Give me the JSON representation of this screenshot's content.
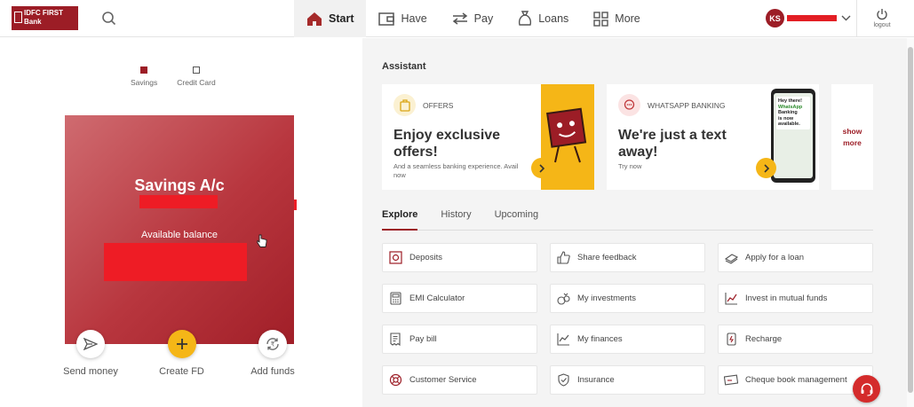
{
  "brand": {
    "logo_text_1": "IDFC FIRST",
    "logo_text_2": "Bank"
  },
  "nav": {
    "items": [
      {
        "label": "Start",
        "icon": "home-icon",
        "active": true
      },
      {
        "label": "Have",
        "icon": "wallet-icon",
        "active": false
      },
      {
        "label": "Pay",
        "icon": "transfer-arrows-icon",
        "active": false
      },
      {
        "label": "Loans",
        "icon": "money-bag-icon",
        "active": false
      },
      {
        "label": "More",
        "icon": "grid-icon",
        "active": false
      }
    ]
  },
  "user": {
    "initials": "KS"
  },
  "logout_label": "logout",
  "account_tabs": [
    {
      "label": "Savings",
      "active": true
    },
    {
      "label": "Credit Card",
      "active": false
    }
  ],
  "account_card": {
    "title": "Savings A/c",
    "balance_label": "Available balance"
  },
  "quick_actions": [
    {
      "label": "Send money",
      "icon": "send-icon"
    },
    {
      "label": "Create FD",
      "icon": "plus-icon"
    },
    {
      "label": "Add funds",
      "icon": "refresh-money-icon"
    }
  ],
  "assistant": {
    "title": "Assistant",
    "cards": [
      {
        "tag": "OFFERS",
        "headline_1": "Enjoy exclusive",
        "headline_2": "offers!",
        "sub_1": "And a seamless banking experience. Avail",
        "sub_2": "now"
      },
      {
        "tag": "WHATSAPP BANKING",
        "headline_1": "We're just a text",
        "headline_2": "away!",
        "sub_1": "Try now",
        "sub_2": ""
      }
    ],
    "phone_text": {
      "line1": "Hey there!",
      "line2": "WhatsApp",
      "line3": "Banking",
      "line4": "is now",
      "line5": "available."
    },
    "show_more_1": "show",
    "show_more_2": "more"
  },
  "section_tabs": [
    {
      "label": "Explore",
      "active": true
    },
    {
      "label": "History",
      "active": false
    },
    {
      "label": "Upcoming",
      "active": false
    }
  ],
  "explore": [
    {
      "label": "Deposits",
      "icon": "deposit-icon"
    },
    {
      "label": "Share feedback",
      "icon": "thumbs-up-icon"
    },
    {
      "label": "Apply for a loan",
      "icon": "money-stack-icon"
    },
    {
      "label": "EMI Calculator",
      "icon": "calculator-icon"
    },
    {
      "label": "My investments",
      "icon": "investment-bag-icon"
    },
    {
      "label": "Invest in mutual funds",
      "icon": "trend-chart-icon"
    },
    {
      "label": "Pay bill",
      "icon": "bill-icon"
    },
    {
      "label": "My finances",
      "icon": "line-chart-icon"
    },
    {
      "label": "Recharge",
      "icon": "mobile-recharge-icon"
    },
    {
      "label": "Customer Service",
      "icon": "support-icon"
    },
    {
      "label": "Insurance",
      "icon": "shield-icon"
    },
    {
      "label": "Cheque book management",
      "icon": "cheque-icon"
    }
  ],
  "colors": {
    "brand": "#9c1d26",
    "accent_yellow": "#f5b617",
    "redaction": "#ee1c25"
  }
}
